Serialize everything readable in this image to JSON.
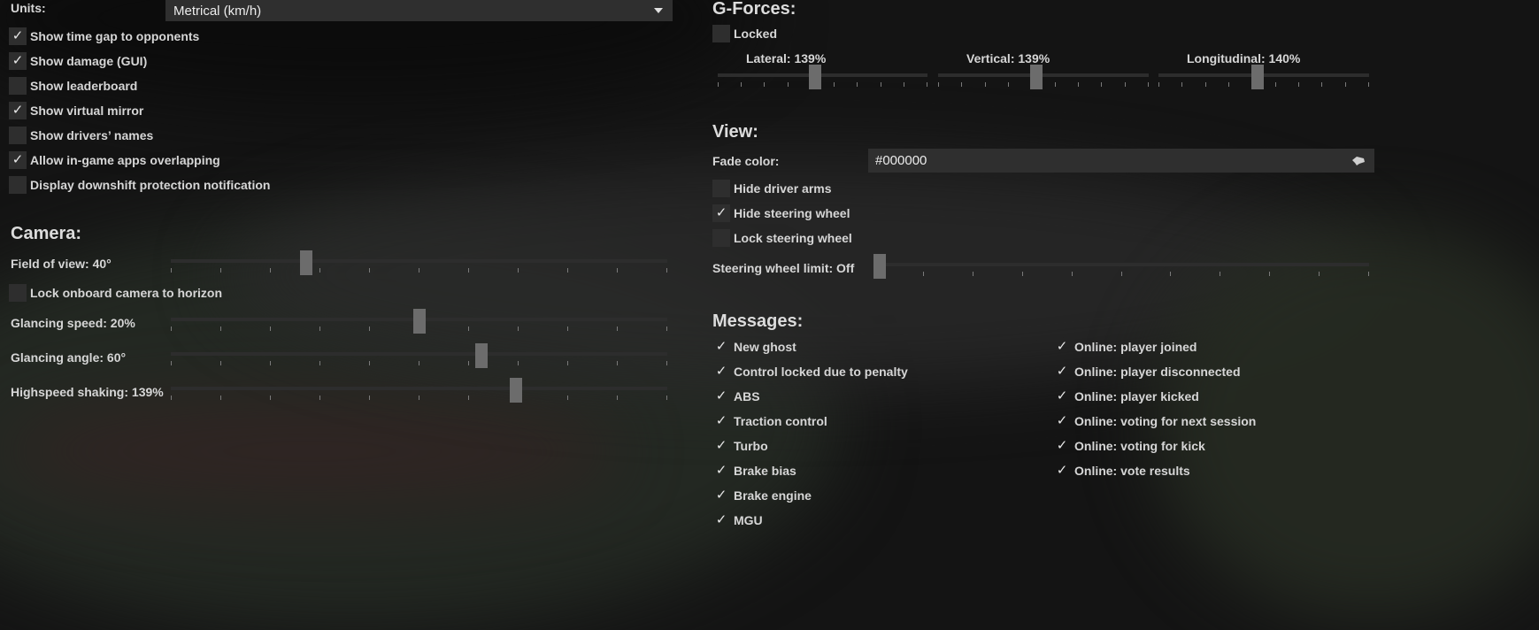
{
  "general": {
    "units_label": "Units:",
    "units_value": "Metrical (km/h)",
    "options": [
      {
        "label": "Show time gap to opponents",
        "checked": true
      },
      {
        "label": "Show damage (GUI)",
        "checked": true
      },
      {
        "label": "Show leaderboard",
        "checked": false
      },
      {
        "label": "Show virtual mirror",
        "checked": true
      },
      {
        "label": "Show drivers’ names",
        "checked": false
      },
      {
        "label": "Allow in-game apps overlapping",
        "checked": true
      },
      {
        "label": "Display downshift protection notification",
        "checked": false
      }
    ]
  },
  "camera": {
    "title": "Camera:",
    "fov": {
      "label": "Field of view: 40°",
      "fraction": 0.273
    },
    "lock_horizon": {
      "label": "Lock onboard camera to horizon",
      "checked": false
    },
    "glancing_speed": {
      "label": "Glancing speed: 20%",
      "fraction": 0.5
    },
    "glancing_angle": {
      "label": "Glancing angle: 60°",
      "fraction": 0.625
    },
    "highspeed_shaking": {
      "label": "Highspeed shaking: 139%",
      "fraction": 0.695
    }
  },
  "gforces": {
    "title": "G-Forces:",
    "locked": {
      "label": "Locked",
      "checked": false
    },
    "lateral": {
      "label": "Lateral: 139%",
      "fraction": 0.465
    },
    "vertical": {
      "label": "Vertical: 139%",
      "fraction": 0.465
    },
    "longitudinal": {
      "label": "Longitudinal: 140%",
      "fraction": 0.47
    }
  },
  "view": {
    "title": "View:",
    "fade_color_label": "Fade color:",
    "fade_color_value": "#000000",
    "hide_driver_arms": {
      "label": "Hide driver arms",
      "checked": false
    },
    "hide_steering_wheel": {
      "label": "Hide steering wheel",
      "checked": true
    },
    "lock_steering_wheel": {
      "label": "Lock steering wheel",
      "checked": false
    },
    "steering_limit": {
      "label": "Steering wheel limit: Off",
      "fraction": 0.0
    }
  },
  "messages": {
    "title": "Messages:",
    "left": [
      {
        "label": "New ghost",
        "checked": true
      },
      {
        "label": "Control locked due to penalty",
        "checked": true
      },
      {
        "label": "ABS",
        "checked": true
      },
      {
        "label": "Traction control",
        "checked": true
      },
      {
        "label": "Turbo",
        "checked": true
      },
      {
        "label": "Brake bias",
        "checked": true
      },
      {
        "label": "Brake engine",
        "checked": true
      },
      {
        "label": "MGU",
        "checked": true
      }
    ],
    "right": [
      {
        "label": "Online: player joined",
        "checked": true
      },
      {
        "label": "Online: player disconnected",
        "checked": true
      },
      {
        "label": "Online: player kicked",
        "checked": true
      },
      {
        "label": "Online: voting for next session",
        "checked": true
      },
      {
        "label": "Online: voting for kick",
        "checked": true
      },
      {
        "label": "Online: vote results",
        "checked": true
      }
    ]
  },
  "icons": {
    "check": "checkmark-icon",
    "dropdown": "chevron-down-icon",
    "picker": "eyedropper-icon"
  }
}
